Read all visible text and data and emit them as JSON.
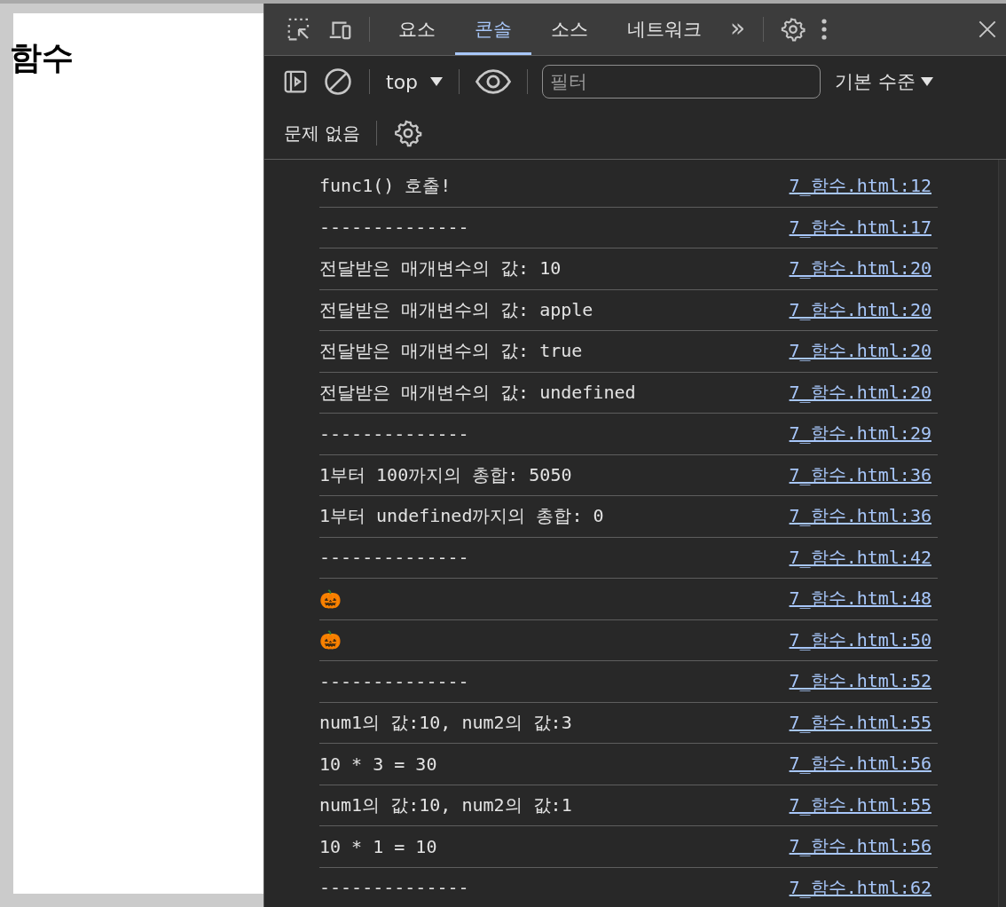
{
  "page": {
    "heading": "함수"
  },
  "devtools": {
    "tabs": [
      {
        "label": "요소",
        "selected": false
      },
      {
        "label": "콘솔",
        "selected": true
      },
      {
        "label": "소스",
        "selected": false
      },
      {
        "label": "네트워크",
        "selected": false
      }
    ],
    "more_tabs": "»",
    "toolbar": {
      "context": "top",
      "filter": {
        "placeholder": "필터"
      },
      "levels": "기본 수준"
    },
    "issues": "문제 없음",
    "messages": [
      {
        "text": "func1() 호출!",
        "source": "7_함수.html:12"
      },
      {
        "text": "--------------",
        "source": "7_함수.html:17"
      },
      {
        "text": "전달받은 매개변수의 값: 10",
        "source": "7_함수.html:20"
      },
      {
        "text": "전달받은 매개변수의 값: apple",
        "source": "7_함수.html:20"
      },
      {
        "text": "전달받은 매개변수의 값: true",
        "source": "7_함수.html:20"
      },
      {
        "text": "전달받은 매개변수의 값: undefined",
        "source": "7_함수.html:20"
      },
      {
        "text": "--------------",
        "source": "7_함수.html:29"
      },
      {
        "text": "1부터 100까지의 총합: 5050",
        "source": "7_함수.html:36"
      },
      {
        "text": "1부터 undefined까지의 총합: 0",
        "source": "7_함수.html:36"
      },
      {
        "text": "--------------",
        "source": "7_함수.html:42"
      },
      {
        "text": "🎃",
        "source": "7_함수.html:48"
      },
      {
        "text": "🎃",
        "source": "7_함수.html:50"
      },
      {
        "text": "--------------",
        "source": "7_함수.html:52"
      },
      {
        "text": "num1의 값:10, num2의 값:3",
        "source": "7_함수.html:55"
      },
      {
        "text": "10 * 3 = 30",
        "source": "7_함수.html:56"
      },
      {
        "text": "num1의 값:10, num2의 값:1",
        "source": "7_함수.html:55"
      },
      {
        "text": "10 * 1 = 10",
        "source": "7_함수.html:56"
      },
      {
        "text": "--------------",
        "source": "7_함수.html:62"
      }
    ]
  }
}
